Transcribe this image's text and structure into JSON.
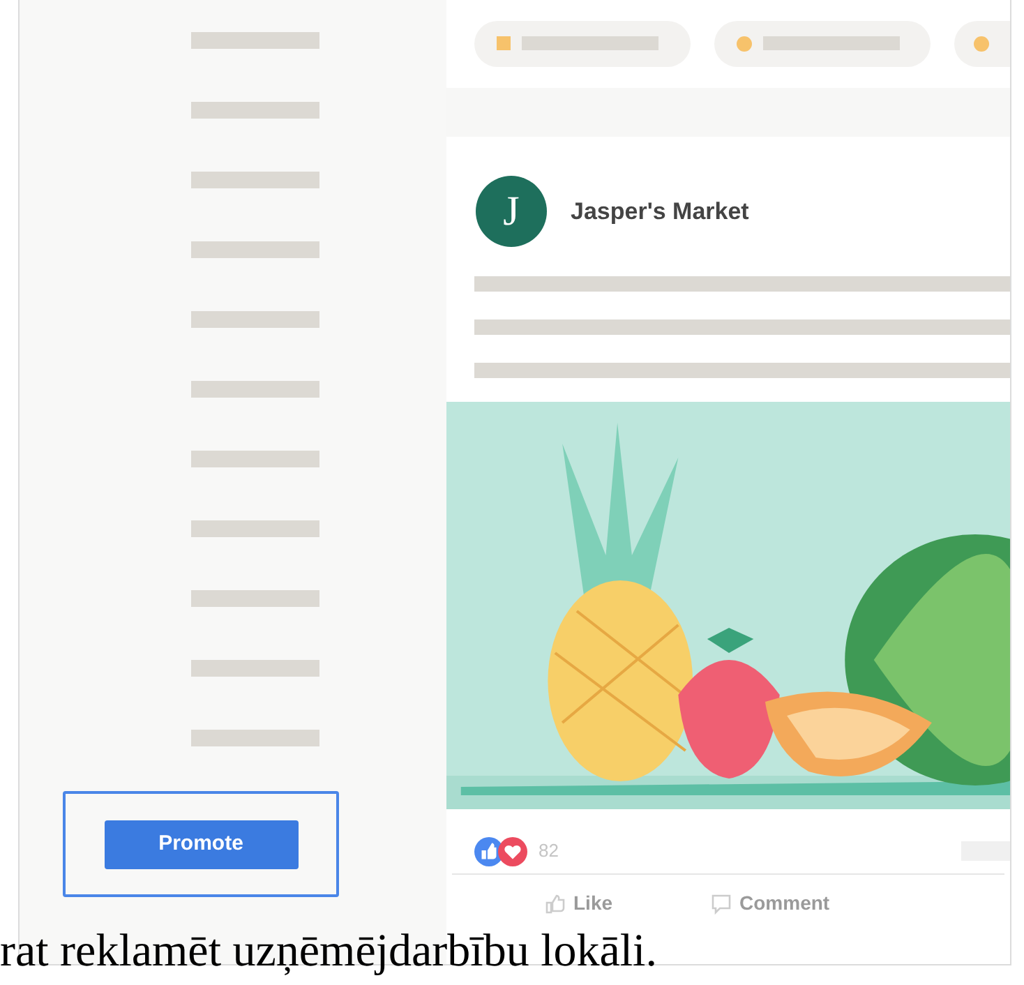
{
  "sidebar": {
    "button": "Promote"
  },
  "post": {
    "avatar_letter": "J",
    "page_name": "Jasper's Market",
    "reaction_count": "82",
    "actions": [
      "Like",
      "Comment"
    ]
  },
  "caption": "rat reklamēt uzņēmējdarbību lokāli."
}
